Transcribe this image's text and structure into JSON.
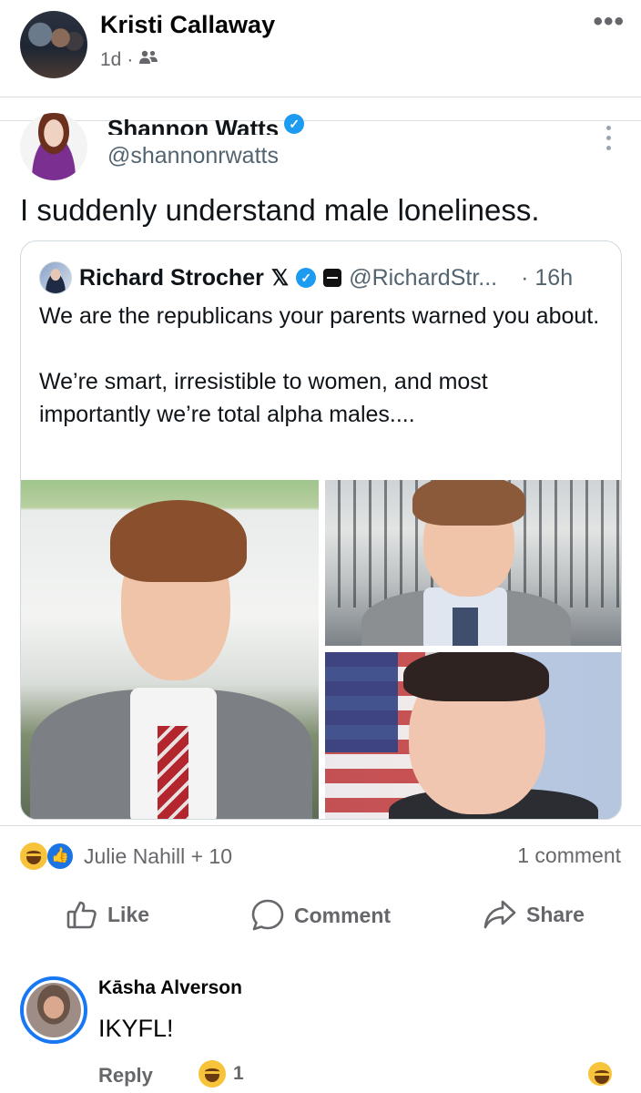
{
  "post": {
    "author": "Kristi Callaway",
    "time": "1d",
    "meta_separator": "·",
    "audience_icon": "friends-icon",
    "more_icon": "•••"
  },
  "tweet": {
    "author": "Shannon Watts",
    "handle": "@shannonrwatts",
    "verified_glyph": "✓",
    "text": "I suddenly understand male loneliness.",
    "quoted": {
      "author": "Richard Strocher",
      "x_glyph": "𝕏",
      "handle": "@RichardStr...",
      "time": "· 16h",
      "lines": [
        "We are the republicans your parents warned you about.",
        "We’re smart, irresistible to women, and most importantly we’re total alpha males...."
      ]
    }
  },
  "reactions": {
    "names": "Julie Nahill + 10",
    "comment_count": "1 comment",
    "like_glyph": "👍"
  },
  "actions": {
    "like": "Like",
    "comment": "Comment",
    "share": "Share"
  },
  "comment": {
    "author": "Kāsha Alverson",
    "text": "IKYFL!",
    "reply": "Reply",
    "reaction_count": "1"
  },
  "colors": {
    "fb_blue": "#1877f2",
    "twitter_blue": "#1d9bf0",
    "secondary_text": "#65676b",
    "haha_yellow": "#f7c33b"
  }
}
